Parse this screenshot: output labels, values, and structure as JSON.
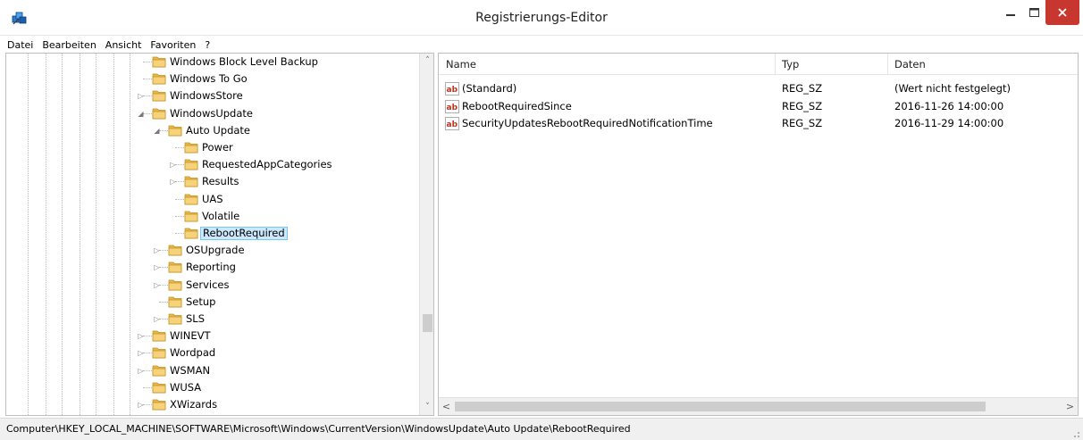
{
  "window": {
    "title": "Registrierungs-Editor",
    "close_color": "#c7372f"
  },
  "menu": [
    "Datei",
    "Bearbeiten",
    "Ansicht",
    "Favoriten",
    "?"
  ],
  "tree": {
    "rows": [
      {
        "label": "Windows Block Level Backup",
        "depth": 0,
        "expander": "none"
      },
      {
        "label": "Windows To Go",
        "depth": 0,
        "expander": "none"
      },
      {
        "label": "WindowsStore",
        "depth": 0,
        "expander": "collapsed"
      },
      {
        "label": "WindowsUpdate",
        "depth": 0,
        "expander": "expanded"
      },
      {
        "label": "Auto Update",
        "depth": 1,
        "expander": "expanded"
      },
      {
        "label": "Power",
        "depth": 2,
        "expander": "none"
      },
      {
        "label": "RequestedAppCategories",
        "depth": 2,
        "expander": "collapsed"
      },
      {
        "label": "Results",
        "depth": 2,
        "expander": "collapsed"
      },
      {
        "label": "UAS",
        "depth": 2,
        "expander": "none"
      },
      {
        "label": "Volatile",
        "depth": 2,
        "expander": "none"
      },
      {
        "label": "RebootRequired",
        "depth": 2,
        "expander": "none",
        "selected": true
      },
      {
        "label": "OSUpgrade",
        "depth": 1,
        "expander": "collapsed"
      },
      {
        "label": "Reporting",
        "depth": 1,
        "expander": "collapsed"
      },
      {
        "label": "Services",
        "depth": 1,
        "expander": "collapsed"
      },
      {
        "label": "Setup",
        "depth": 1,
        "expander": "none"
      },
      {
        "label": "SLS",
        "depth": 1,
        "expander": "collapsed"
      },
      {
        "label": "WINEVT",
        "depth": 0,
        "expander": "collapsed"
      },
      {
        "label": "Wordpad",
        "depth": 0,
        "expander": "collapsed"
      },
      {
        "label": "WSMAN",
        "depth": 0,
        "expander": "collapsed"
      },
      {
        "label": "WUSA",
        "depth": 0,
        "expander": "none"
      },
      {
        "label": "XWizards",
        "depth": 0,
        "expander": "collapsed"
      }
    ],
    "scroll_up": "˄",
    "scroll_down": "˅"
  },
  "list": {
    "columns": [
      "Name",
      "Typ",
      "Daten"
    ],
    "rows": [
      {
        "name": "(Standard)",
        "type": "REG_SZ",
        "data": "(Wert nicht festgelegt)",
        "icon": "string-value-icon"
      },
      {
        "name": "RebootRequiredSince",
        "type": "REG_SZ",
        "data": "2016-11-26 14:00:00",
        "icon": "string-value-icon"
      },
      {
        "name": "SecurityUpdatesRebootRequiredNotificationTime",
        "type": "REG_SZ",
        "data": "2016-11-29 14:00:00",
        "icon": "string-value-icon"
      }
    ],
    "scroll_left": "<",
    "scroll_right": ">"
  },
  "status": {
    "path": "Computer\\HKEY_LOCAL_MACHINE\\SOFTWARE\\Microsoft\\Windows\\CurrentVersion\\WindowsUpdate\\Auto Update\\RebootRequired"
  }
}
